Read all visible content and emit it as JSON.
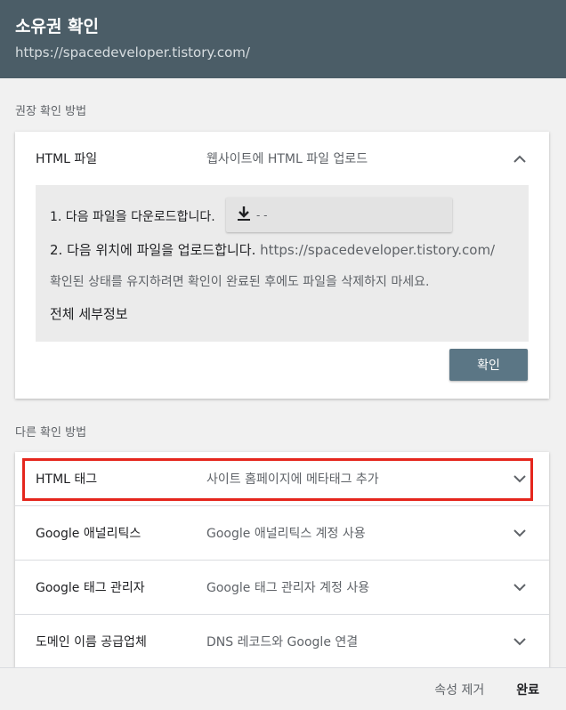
{
  "header": {
    "title": "소유권 확인",
    "url": "https://spacedeveloper.tistory.com/"
  },
  "recommended": {
    "section_label": "권장 확인 방법",
    "method": "HTML 파일",
    "description": "웹사이트에 HTML 파일 업로드",
    "expanded": true,
    "step1_label": "1. 다음 파일을 다운로드합니다.",
    "download_file_name": "-     -",
    "step2_label": "2. 다음 위치에 파일을 업로드합니다.",
    "step2_url": "https://spacedeveloper.tistory.com/",
    "note": "확인된 상태를 유지하려면 확인이 완료된 후에도 파일을 삭제하지 마세요.",
    "details_link": "전체 세부정보",
    "confirm_label": "확인"
  },
  "other": {
    "section_label": "다른 확인 방법",
    "methods": [
      {
        "name": "HTML 태그",
        "description": "사이트 홈페이지에 메타태그 추가",
        "highlighted": true
      },
      {
        "name": "Google 애널리틱스",
        "description": "Google 애널리틱스 계정 사용"
      },
      {
        "name": "Google 태그 관리자",
        "description": "Google 태그 관리자 계정 사용"
      },
      {
        "name": "도메인 이름 공급업체",
        "description": "DNS 레코드와 Google 연결"
      }
    ]
  },
  "footer": {
    "remove_property": "속성 제거",
    "done": "완료"
  },
  "colors": {
    "header_bg": "#4b5d67",
    "confirm_btn": "#5b7685",
    "link": "#1a73e8",
    "highlight": "#e5261d"
  },
  "icons": {
    "expanded_chevron": "chevron-up-icon",
    "collapsed_chevron": "chevron-down-icon",
    "download": "download-icon"
  }
}
